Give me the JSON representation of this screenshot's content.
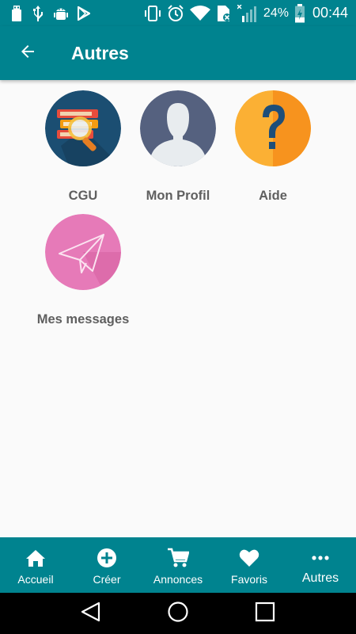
{
  "status_bar": {
    "battery_percent": "24%",
    "time": "00:44",
    "icons": [
      "usb-icon",
      "usb-icon",
      "android-debug-icon",
      "play-store-icon",
      "vibrate-icon",
      "alarm-icon",
      "wifi-icon",
      "sim-off-icon",
      "signal-icon",
      "battery-charging-icon"
    ]
  },
  "app_bar": {
    "title": "Autres",
    "back_icon": "arrow-back-icon"
  },
  "tiles": [
    {
      "label": "CGU",
      "icon": "books-search-icon"
    },
    {
      "label": "Mon Profil",
      "icon": "user-profile-icon"
    },
    {
      "label": "Aide",
      "icon": "question-icon"
    },
    {
      "label": "Mes messages",
      "icon": "paper-plane-icon"
    }
  ],
  "bottom_nav": {
    "items": [
      {
        "label": "Accueil",
        "icon": "home-icon"
      },
      {
        "label": "Créer",
        "icon": "plus-circle-icon"
      },
      {
        "label": "Annonces",
        "icon": "cart-icon"
      },
      {
        "label": "Favoris",
        "icon": "heart-icon"
      },
      {
        "label": "Autres",
        "icon": "more-icon",
        "active": true
      }
    ]
  },
  "colors": {
    "primary": "#00838f",
    "label_gray": "#5f5f5f",
    "background": "#fafafa"
  }
}
